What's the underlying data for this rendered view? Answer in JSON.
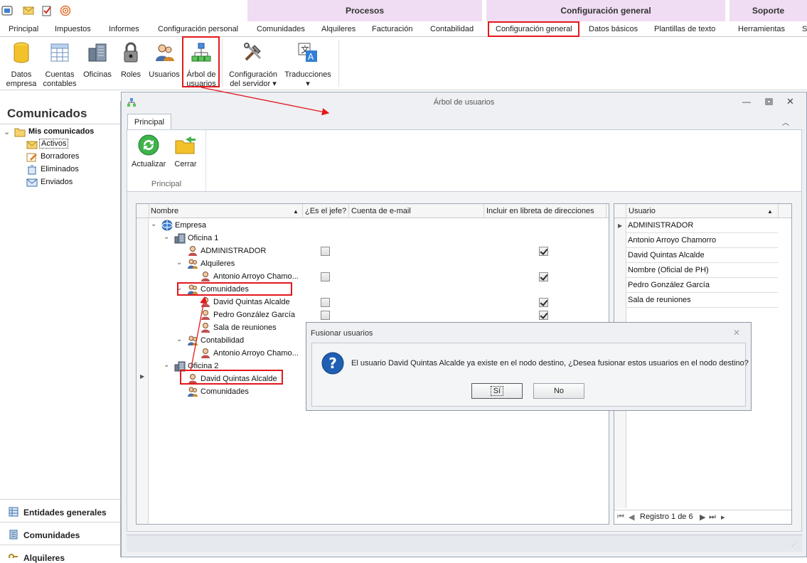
{
  "ribbon": {
    "context_groups": [
      "Procesos",
      "Configuración general",
      "Soporte"
    ],
    "tabs": [
      "Principal",
      "Impuestos",
      "Informes",
      "Configuración personal",
      "Comunidades",
      "Alquileres",
      "Facturación",
      "Contabilidad",
      "Configuración general",
      "Datos básicos",
      "Plantillas de texto",
      "Herramientas",
      "S"
    ],
    "active_tab": "Configuración general",
    "buttons": [
      {
        "label": "Datos empresa",
        "line1": "Datos",
        "line2": "empresa",
        "icon": "database-icon"
      },
      {
        "label": "Cuentas contables",
        "line1": "Cuentas",
        "line2": "contables",
        "icon": "spreadsheet-icon"
      },
      {
        "label": "Oficinas",
        "line1": "Oficinas",
        "line2": "",
        "icon": "offices-icon"
      },
      {
        "label": "Roles",
        "line1": "Roles",
        "line2": "",
        "icon": "lock-icon"
      },
      {
        "label": "Usuarios",
        "line1": "Usuarios",
        "line2": "",
        "icon": "users-icon"
      },
      {
        "label": "Árbol de usuarios",
        "line1": "Árbol de",
        "line2": "usuarios",
        "icon": "org-tree-icon"
      },
      {
        "label": "Configuración del servidor",
        "line1": "Configuración",
        "line2": "del servidor ▾",
        "icon": "tools-icon"
      },
      {
        "label": "Traducciones",
        "line1": "Traducciones",
        "line2": "▾",
        "icon": "translate-icon"
      }
    ]
  },
  "leftnav": {
    "title": "Comunicados",
    "root": "Mis comunicados",
    "items": [
      "Activos",
      "Borradores",
      "Eliminados",
      "Enviados"
    ],
    "bottom": [
      "Entidades generales",
      "Comunidades",
      "Alquileres"
    ]
  },
  "window": {
    "title": "Árbol de usuarios",
    "tab": "Principal",
    "actions": [
      "Actualizar",
      "Cerrar"
    ],
    "group_label": "Principal",
    "grid": {
      "columns": [
        "Nombre",
        "¿Es el jefe?",
        "Cuenta de e-mail",
        "Incluir en libreta de direcciones"
      ],
      "rows": [
        {
          "name": "Empresa",
          "level": 0,
          "icon": "company-icon",
          "expand": true
        },
        {
          "name": "Oficina 1",
          "level": 1,
          "icon": "office-icon",
          "expand": true
        },
        {
          "name": "ADMINISTRADOR",
          "level": 2,
          "icon": "user-icon",
          "boss": false,
          "book": true
        },
        {
          "name": "Alquileres",
          "level": 2,
          "icon": "group-icon",
          "expand": true
        },
        {
          "name": "Antonio Arroyo Chamo...",
          "level": 3,
          "icon": "user-icon",
          "boss": false,
          "book": true
        },
        {
          "name": "Comunidades",
          "level": 2,
          "icon": "group-icon",
          "expand": true
        },
        {
          "name": "David Quintas Alcalde",
          "level": 3,
          "icon": "user-icon",
          "boss": false,
          "book": true
        },
        {
          "name": "Pedro González García",
          "level": 3,
          "icon": "user-icon",
          "boss": false,
          "book": true
        },
        {
          "name": "Sala de reuniones",
          "level": 3,
          "icon": "user-icon"
        },
        {
          "name": "Contabilidad",
          "level": 2,
          "icon": "group-icon",
          "expand": true
        },
        {
          "name": "Antonio Arroyo Chamo...",
          "level": 3,
          "icon": "user-icon"
        },
        {
          "name": "Oficina 2",
          "level": 1,
          "icon": "office-icon",
          "expand": true
        },
        {
          "name": "David Quintas Alcalde",
          "level": 2,
          "icon": "user-icon"
        },
        {
          "name": "Comunidades",
          "level": 2,
          "icon": "group-icon"
        }
      ]
    },
    "users_grid": {
      "column": "Usuario",
      "rows": [
        "ADMINISTRADOR",
        "Antonio Arroyo Chamorro",
        "David Quintas Alcalde",
        "Nombre (Oficial de PH)",
        "Pedro González García",
        "Sala de reuniones"
      ],
      "pager": "Registro 1 de 6"
    }
  },
  "dialog": {
    "title": "Fusionar usuarios",
    "message": "El usuario David Quintas Alcalde ya existe en el nodo destino, ¿Desea fusionar estos usuarios en el nodo destino?",
    "yes": "Sí",
    "no": "No"
  },
  "colors": {
    "highlight": "#e3181c",
    "context_band": "#f0dcf3",
    "info_blue": "#1e5fb4"
  }
}
